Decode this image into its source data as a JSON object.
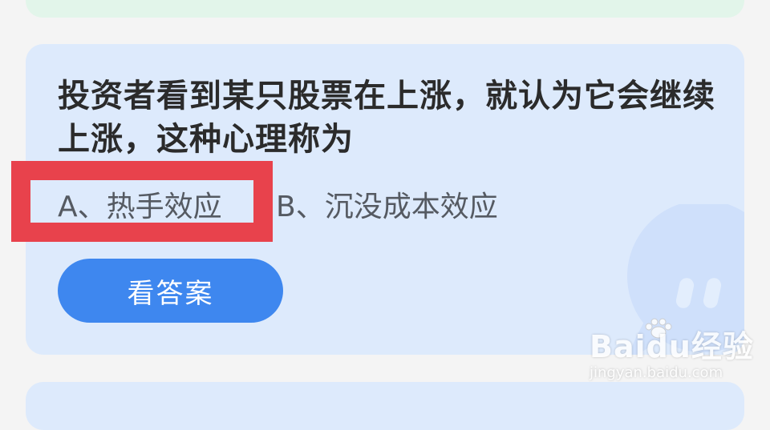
{
  "quiz": {
    "question": "投资者看到某只股票在上涨，就认为它会继续上涨，这种心理称为",
    "option_a": "A、热手效应",
    "option_b": "B、沉没成本效应",
    "answer_button": "看答案"
  },
  "watermark": {
    "logo": "Baidu经验",
    "url": "jingyan.baidu.com"
  },
  "colors": {
    "card_bg": "#ddeafc",
    "top_card_bg": "#e2f5ea",
    "button_bg": "#3e87ef",
    "highlight": "#e8424c"
  },
  "icons": [
    "chat-bubble-mascot-icon",
    "baidu-paw-icon"
  ]
}
